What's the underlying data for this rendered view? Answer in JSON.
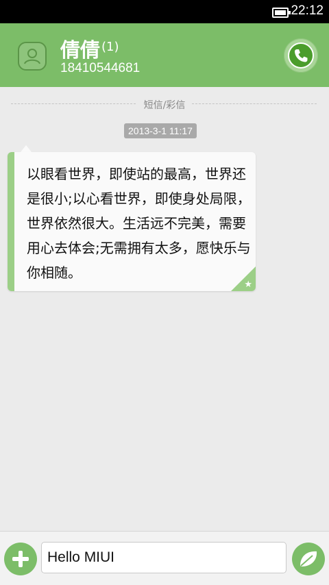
{
  "status_bar": {
    "time": "22:12"
  },
  "header": {
    "contact_name": "倩倩",
    "message_count": "(1)",
    "phone_number": "18410544681"
  },
  "divider": {
    "label": "短信/彩信"
  },
  "conversation": {
    "timestamp": "2013-3-1 11:17",
    "messages": [
      {
        "text": "以眼看世界，即使站的最高，世界还是很小;以心看世界，即使身处局限，世界依然很大。生活远不完美，需要用心去体会;无需拥有太多，愿快乐与你相随。",
        "starred": true
      }
    ]
  },
  "composer": {
    "input_value": "Hello MIUI"
  },
  "colors": {
    "accent": "#7cbd68",
    "status_bar": "#000000",
    "bubble_bar": "#9ccf87"
  },
  "icons": {
    "avatar": "contact-avatar-icon",
    "call": "phone-icon",
    "add": "plus-icon",
    "send": "leaf-send-icon",
    "star": "star-icon",
    "battery": "battery-icon"
  }
}
